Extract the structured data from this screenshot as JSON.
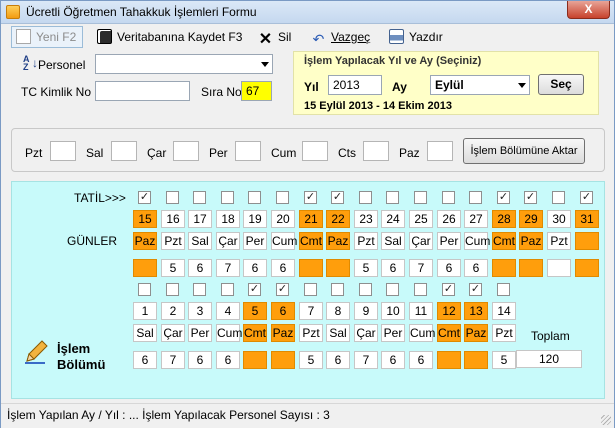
{
  "window": {
    "title": "Ücretli Öğretmen Tahakkuk İşlemleri Formu",
    "close_label": "X"
  },
  "toolbar": {
    "new_label": "Yeni  F2",
    "save_label": "Veritabanına Kaydet F3",
    "delete_label": "Sil",
    "cancel_label": "Vazgeç",
    "print_label": "Yazdır"
  },
  "form": {
    "personel_label": "Personel",
    "personel_value": "",
    "tc_label": "TC Kimlik No",
    "tc_value": "",
    "sira_label": "Sıra No",
    "sira_value": "67"
  },
  "period": {
    "title": "İşlem Yapılacak Yıl ve Ay (Seçiniz)",
    "year_label": "Yıl",
    "year_value": "2013",
    "month_label": "Ay",
    "month_value": "Eylül",
    "select_label": "Seç",
    "range_text": "15 Eylül 2013 - 14 Ekim 2013"
  },
  "weekdays": {
    "labels": [
      "Pzt",
      "Sal",
      "Çar",
      "Per",
      "Cum",
      "Cts",
      "Paz"
    ],
    "transfer_label": "İşlem Bölümüne Aktar"
  },
  "grid": {
    "tatil_label": "TATİL>>>",
    "gunler_label": "GÜNLER",
    "row1": [
      {
        "day": "15",
        "name": "Paz",
        "tatil": true,
        "hl": true,
        "val": ""
      },
      {
        "day": "16",
        "name": "Pzt",
        "tatil": false,
        "hl": false,
        "val": "5"
      },
      {
        "day": "17",
        "name": "Sal",
        "tatil": false,
        "hl": false,
        "val": "6"
      },
      {
        "day": "18",
        "name": "Çar",
        "tatil": false,
        "hl": false,
        "val": "7"
      },
      {
        "day": "19",
        "name": "Per",
        "tatil": false,
        "hl": false,
        "val": "6"
      },
      {
        "day": "20",
        "name": "Cum",
        "tatil": false,
        "hl": false,
        "val": "6"
      },
      {
        "day": "21",
        "name": "Cmt",
        "tatil": true,
        "hl": true,
        "val": ""
      },
      {
        "day": "22",
        "name": "Paz",
        "tatil": true,
        "hl": true,
        "val": ""
      },
      {
        "day": "23",
        "name": "Pzt",
        "tatil": false,
        "hl": false,
        "val": "5"
      },
      {
        "day": "24",
        "name": "Sal",
        "tatil": false,
        "hl": false,
        "val": "6"
      },
      {
        "day": "25",
        "name": "Çar",
        "tatil": false,
        "hl": false,
        "val": "7"
      },
      {
        "day": "26",
        "name": "Per",
        "tatil": false,
        "hl": false,
        "val": "6"
      },
      {
        "day": "27",
        "name": "Cum",
        "tatil": false,
        "hl": false,
        "val": "6"
      },
      {
        "day": "28",
        "name": "Cmt",
        "tatil": true,
        "hl": true,
        "val": ""
      },
      {
        "day": "29",
        "name": "Paz",
        "tatil": true,
        "hl": true,
        "val": ""
      },
      {
        "day": "30",
        "name": "Pzt",
        "tatil": false,
        "hl": false,
        "val": ""
      },
      {
        "day": "31",
        "name": "",
        "tatil": true,
        "hl": true,
        "val": ""
      }
    ],
    "row2": [
      {
        "day": "1",
        "name": "Sal",
        "tatil": false,
        "hl": false,
        "val": "6"
      },
      {
        "day": "2",
        "name": "Çar",
        "tatil": false,
        "hl": false,
        "val": "7"
      },
      {
        "day": "3",
        "name": "Per",
        "tatil": false,
        "hl": false,
        "val": "6"
      },
      {
        "day": "4",
        "name": "Cum",
        "tatil": false,
        "hl": false,
        "val": "6"
      },
      {
        "day": "5",
        "name": "Cmt",
        "tatil": true,
        "hl": true,
        "val": ""
      },
      {
        "day": "6",
        "name": "Paz",
        "tatil": true,
        "hl": true,
        "val": ""
      },
      {
        "day": "7",
        "name": "Pzt",
        "tatil": false,
        "hl": false,
        "val": "5"
      },
      {
        "day": "8",
        "name": "Sal",
        "tatil": false,
        "hl": false,
        "val": "6"
      },
      {
        "day": "9",
        "name": "Çar",
        "tatil": false,
        "hl": false,
        "val": "7"
      },
      {
        "day": "10",
        "name": "Per",
        "tatil": false,
        "hl": false,
        "val": "6"
      },
      {
        "day": "11",
        "name": "Cum",
        "tatil": false,
        "hl": false,
        "val": "6"
      },
      {
        "day": "12",
        "name": "Cmt",
        "tatil": true,
        "hl": true,
        "val": ""
      },
      {
        "day": "13",
        "name": "Paz",
        "tatil": true,
        "hl": true,
        "val": ""
      },
      {
        "day": "14",
        "name": "Pzt",
        "tatil": false,
        "hl": false,
        "val": "5"
      }
    ],
    "toplam_label": "Toplam",
    "toplam_value": "120",
    "islem_line1": "İşlem",
    "islem_line2": "Bölümü"
  },
  "status": {
    "text": "İşlem Yapılan Ay / Yıl :  ...  İşlem Yapılacak Personel Sayısı :  3"
  },
  "colors": {
    "highlight": "#ff9e0c",
    "panel": "#c8fafa",
    "yellow": "#ffffc8",
    "sira_bg": "#ffff00"
  },
  "icons": [
    "app-icon",
    "new-doc-icon",
    "save-disk-icon",
    "delete-x-icon",
    "undo-icon",
    "printer-icon",
    "sort-az-icon",
    "pencil-icon"
  ]
}
